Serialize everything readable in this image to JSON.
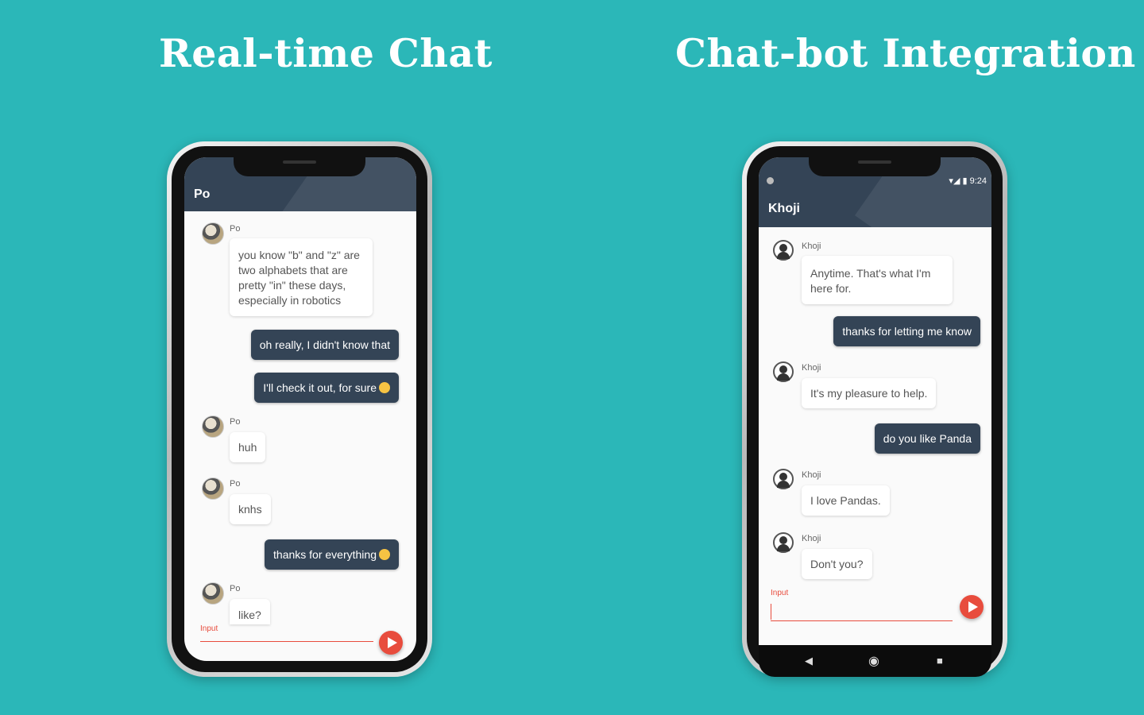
{
  "left": {
    "headline": "Real-time Chat",
    "app_title": "Po",
    "messages": [
      {
        "sender": "Po",
        "text": "you know \"b\" and \"z\" are two alphabets that are pretty \"in\" these days, especially in robotics"
      },
      {
        "text": "oh really, I didn't know that"
      },
      {
        "text": "I'll check it out, for sure",
        "emoji": "wink-emoji"
      },
      {
        "sender": "Po",
        "text": "huh"
      },
      {
        "sender": "Po",
        "text": "knhs"
      },
      {
        "text": "thanks for everything",
        "emoji": "smile-emoji"
      },
      {
        "sender": "Po",
        "text": "like?"
      }
    ],
    "input_label": "Input"
  },
  "right": {
    "headline": "Chat-bot Integration",
    "status_time": "9:24",
    "app_title": "Khoji",
    "messages": [
      {
        "sender": "Khoji",
        "text": "Anytime. That's what I'm here for."
      },
      {
        "text": "thanks for letting me know"
      },
      {
        "sender": "Khoji",
        "text": "It's my pleasure to help."
      },
      {
        "text": "do you like Panda"
      },
      {
        "sender": "Khoji",
        "text": "I love Pandas."
      },
      {
        "sender": "Khoji",
        "text": "Don't you?"
      }
    ],
    "input_label": "Input"
  },
  "icons": {
    "send": "send-icon",
    "nav_back": "back-triangle-icon",
    "nav_home": "home-circle-icon",
    "nav_recent": "recent-square-icon"
  },
  "colors": {
    "background": "#2bb7b8",
    "appbar": "#344456",
    "accent": "#e84c3d"
  }
}
